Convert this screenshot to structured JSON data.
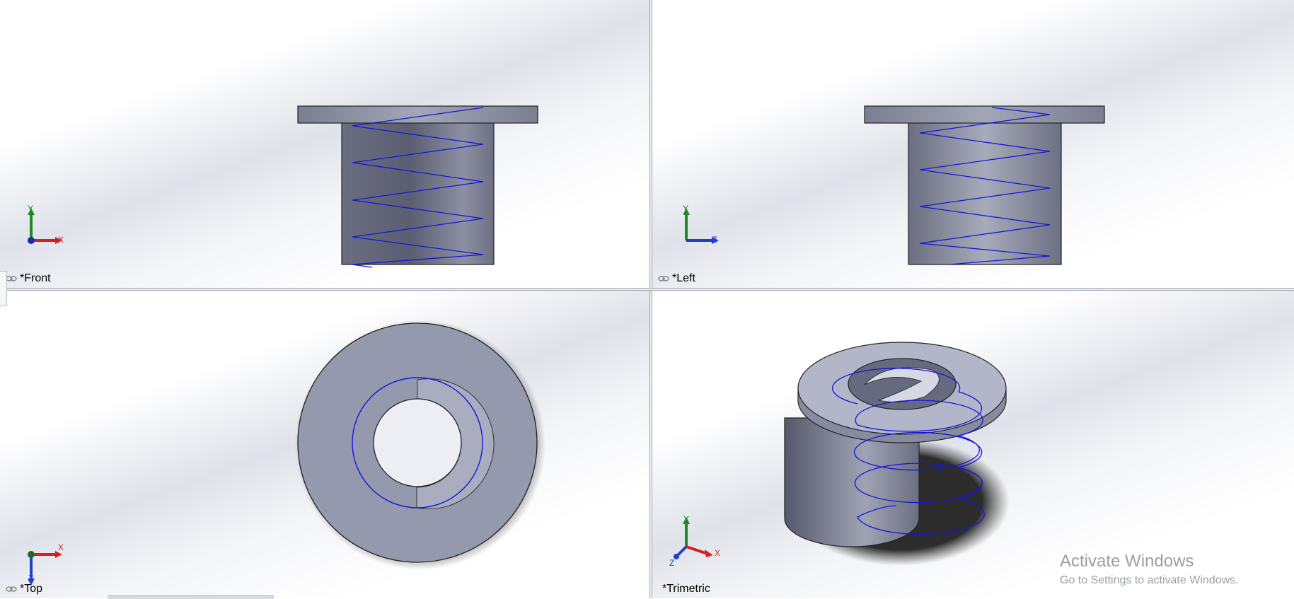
{
  "viewports": {
    "front": {
      "label": "*Front",
      "axes": {
        "vertical": "Y",
        "horizontal": "X"
      }
    },
    "left": {
      "label": "*Left",
      "axes": {
        "vertical": "Y",
        "horizontal": "Z"
      }
    },
    "top": {
      "label": "*Top",
      "axes": {
        "vertical": "Z",
        "horizontal": "X"
      }
    },
    "trimetric": {
      "label": "*Trimetric",
      "axes": {
        "vertical": "Y",
        "horizontal": "X",
        "depth": "Z"
      }
    }
  },
  "watermark": {
    "title": "Activate Windows",
    "subtitle": "Go to Settings to activate Windows."
  },
  "colors": {
    "part_fill": "#8b90a3",
    "helix": "#1010dd",
    "axis_x": "#d42020",
    "axis_y": "#1f8a1f",
    "axis_z": "#2040c8"
  }
}
